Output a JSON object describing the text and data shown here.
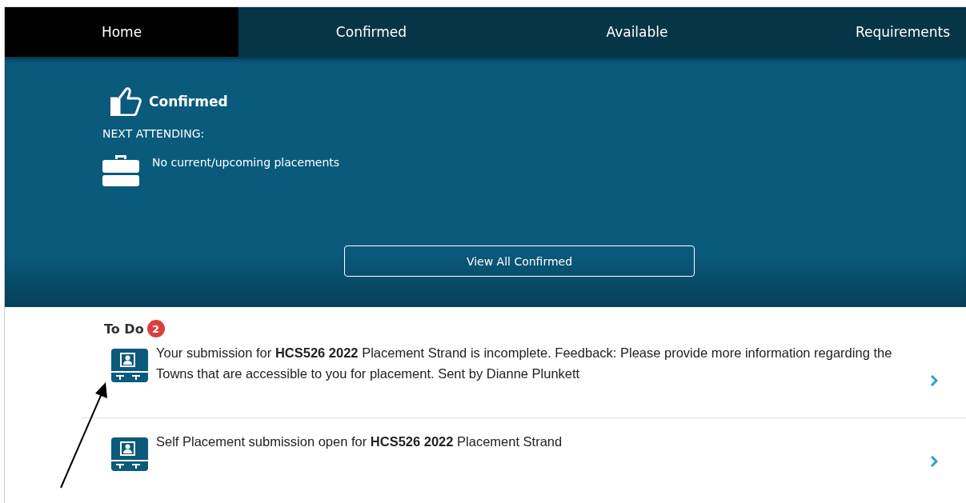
{
  "tabs": [
    {
      "label": "Home",
      "selected": true
    },
    {
      "label": "Confirmed",
      "selected": false
    },
    {
      "label": "Available",
      "selected": false
    },
    {
      "label": "Requirements",
      "selected": false
    }
  ],
  "hero": {
    "title": "Confirmed",
    "next_label": "NEXT ATTENDING:",
    "placement": "No current/upcoming placements",
    "button": "View All Confirmed"
  },
  "todo": {
    "title": "To Do",
    "count": "2",
    "items": [
      {
        "text": "Your submission for **HCS526 2022** Placement Strand is incomplete. Feedback: Please provide more information regarding the Towns that are accessible to you for placement. Sent by Dianne Plunkett"
      },
      {
        "text": "Self Placement submission open for **HCS526 2022** Placement Strand"
      }
    ]
  }
}
